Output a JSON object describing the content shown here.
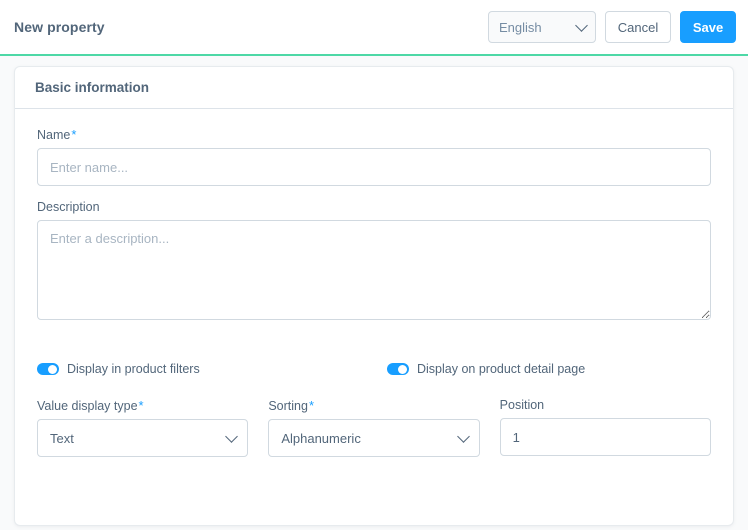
{
  "header": {
    "title": "New property",
    "language_select": {
      "value": "English",
      "chevron_icon": "chevron-down-icon"
    },
    "cancel_label": "Cancel",
    "save_label": "Save",
    "accent_color": "#4dd8a6",
    "primary_color": "#189eff"
  },
  "card": {
    "title": "Basic information",
    "fields": {
      "name": {
        "label": "Name",
        "required_marker": "*",
        "value": "",
        "placeholder": "Enter name..."
      },
      "description": {
        "label": "Description",
        "value": "",
        "placeholder": "Enter a description..."
      },
      "value_display_type": {
        "label": "Value display type",
        "required_marker": "*",
        "value": "Text",
        "chevron_icon": "chevron-down-icon"
      },
      "sorting": {
        "label": "Sorting",
        "required_marker": "*",
        "value": "Alphanumeric",
        "chevron_icon": "chevron-down-icon"
      },
      "position": {
        "label": "Position",
        "value": "1",
        "placeholder": ""
      }
    },
    "switches": [
      {
        "label": "Display in product filters",
        "state": "on"
      },
      {
        "label": "Display on product detail page",
        "state": "on"
      }
    ]
  }
}
